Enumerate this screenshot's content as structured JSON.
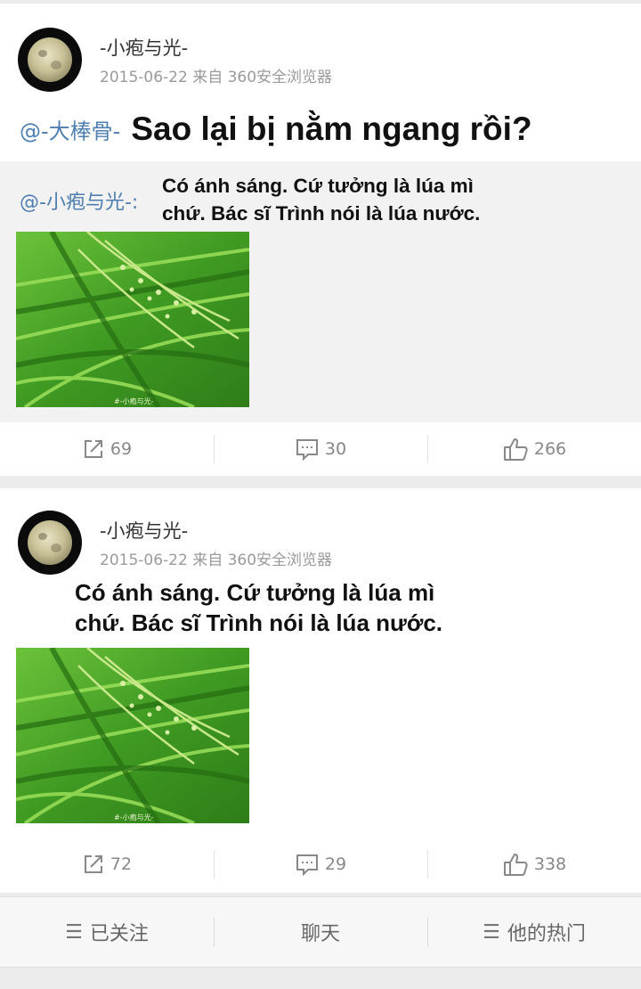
{
  "posts": [
    {
      "username": "-小疱与光-",
      "meta": "2015-06-22 来自 360安全浏览器",
      "mention": "@-大棒骨-",
      "text": "Sao lại bị nằm ngang rồi?",
      "repost": {
        "mention": "@-小疱与光-:",
        "caption_line1": "Có ánh sáng. Cứ tưởng là lúa mì",
        "caption_line2": "chứ. Bác sĩ Trình nói là lúa nước.",
        "watermark": "#-小疱与光-"
      },
      "actions": {
        "repost": "69",
        "comment": "30",
        "like": "266"
      }
    },
    {
      "username": "-小疱与光-",
      "meta": "2015-06-22 来自 360安全浏览器",
      "caption_line1": "Có ánh sáng. Cứ tưởng là lúa mì",
      "caption_line2": "chứ. Bác sĩ Trình nói là lúa nước.",
      "watermark": "#-小疱与光-",
      "actions": {
        "repost": "72",
        "comment": "29",
        "like": "338"
      }
    }
  ],
  "icons": {
    "repost": "repost-icon",
    "comment": "comment-icon",
    "like": "thumbs-up-icon",
    "menu": "menu-icon"
  },
  "bottom_bar": {
    "following": "已关注",
    "chat": "聊天",
    "hot": "他的热门"
  },
  "colors": {
    "mention": "#4e7fb0",
    "meta": "#9a9a9a",
    "background": "#ececec"
  }
}
